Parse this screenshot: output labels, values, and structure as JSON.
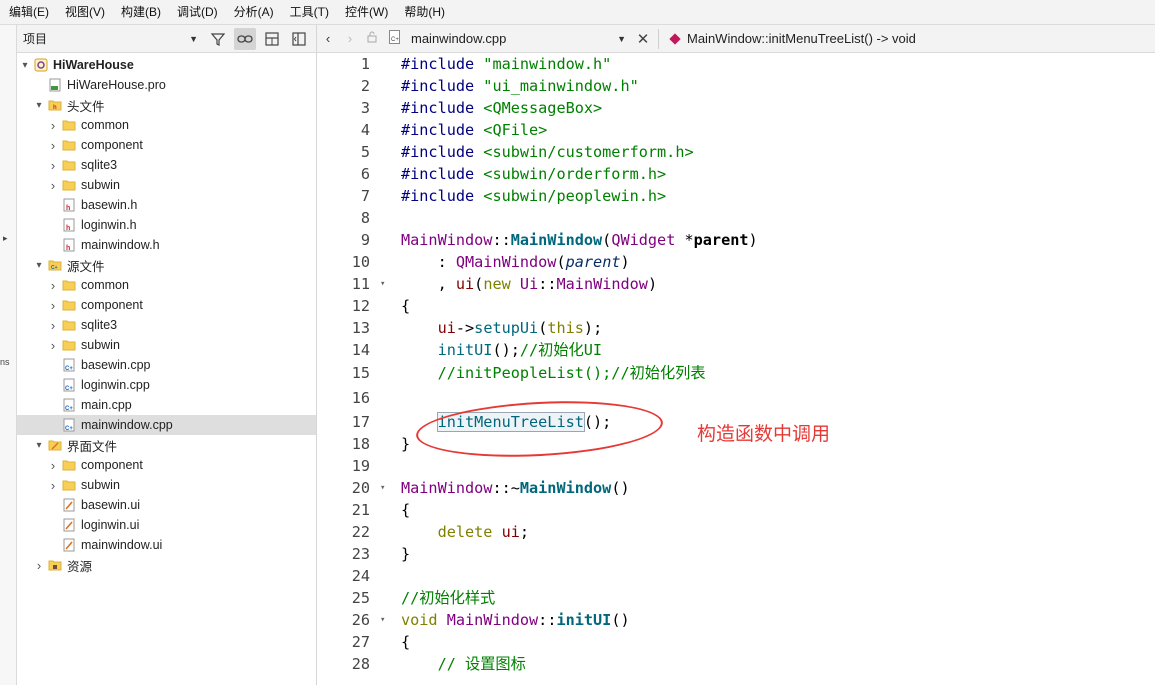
{
  "menu": [
    "编辑(E)",
    "视图(V)",
    "构建(B)",
    "调试(D)",
    "分析(A)",
    "工具(T)",
    "控件(W)",
    "帮助(H)"
  ],
  "mode_strip": {
    "fragment": "ns"
  },
  "project_panel": {
    "selector_label": "项目",
    "tree": [
      {
        "label": "HiWareHouse",
        "depth": 0,
        "arrow": "▾",
        "icon": "project",
        "bold": true
      },
      {
        "label": "HiWareHouse.pro",
        "depth": 1,
        "arrow": "",
        "icon": "pro"
      },
      {
        "label": "头文件",
        "depth": 1,
        "arrow": "▾",
        "icon": "header-folder"
      },
      {
        "label": "common",
        "depth": 2,
        "arrow": "›",
        "icon": "folder"
      },
      {
        "label": "component",
        "depth": 2,
        "arrow": "›",
        "icon": "folder"
      },
      {
        "label": "sqlite3",
        "depth": 2,
        "arrow": "›",
        "icon": "folder"
      },
      {
        "label": "subwin",
        "depth": 2,
        "arrow": "›",
        "icon": "folder"
      },
      {
        "label": "basewin.h",
        "depth": 2,
        "arrow": "",
        "icon": "h"
      },
      {
        "label": "loginwin.h",
        "depth": 2,
        "arrow": "",
        "icon": "h"
      },
      {
        "label": "mainwindow.h",
        "depth": 2,
        "arrow": "",
        "icon": "h"
      },
      {
        "label": "源文件",
        "depth": 1,
        "arrow": "▾",
        "icon": "source-folder"
      },
      {
        "label": "common",
        "depth": 2,
        "arrow": "›",
        "icon": "folder"
      },
      {
        "label": "component",
        "depth": 2,
        "arrow": "›",
        "icon": "folder"
      },
      {
        "label": "sqlite3",
        "depth": 2,
        "arrow": "›",
        "icon": "folder"
      },
      {
        "label": "subwin",
        "depth": 2,
        "arrow": "›",
        "icon": "folder"
      },
      {
        "label": "basewin.cpp",
        "depth": 2,
        "arrow": "",
        "icon": "cpp"
      },
      {
        "label": "loginwin.cpp",
        "depth": 2,
        "arrow": "",
        "icon": "cpp"
      },
      {
        "label": "main.cpp",
        "depth": 2,
        "arrow": "",
        "icon": "cpp"
      },
      {
        "label": "mainwindow.cpp",
        "depth": 2,
        "arrow": "",
        "icon": "cpp",
        "selected": true
      },
      {
        "label": "界面文件",
        "depth": 1,
        "arrow": "▾",
        "icon": "form-folder"
      },
      {
        "label": "component",
        "depth": 2,
        "arrow": "›",
        "icon": "folder"
      },
      {
        "label": "subwin",
        "depth": 2,
        "arrow": "›",
        "icon": "folder"
      },
      {
        "label": "basewin.ui",
        "depth": 2,
        "arrow": "",
        "icon": "ui"
      },
      {
        "label": "loginwin.ui",
        "depth": 2,
        "arrow": "",
        "icon": "ui"
      },
      {
        "label": "mainwindow.ui",
        "depth": 2,
        "arrow": "",
        "icon": "ui"
      },
      {
        "label": "资源",
        "depth": 1,
        "arrow": "›",
        "icon": "resource-folder"
      }
    ]
  },
  "editor_toolbar": {
    "file_name": "mainwindow.cpp",
    "function": "MainWindow::initMenuTreeList() -> void"
  },
  "code_lines": [
    {
      "n": "1",
      "fold": "",
      "tokens": [
        {
          "t": "#include ",
          "c": "pp"
        },
        {
          "t": "\"mainwindow.h\"",
          "c": "str"
        }
      ]
    },
    {
      "n": "2",
      "fold": "",
      "tokens": [
        {
          "t": "#include ",
          "c": "pp"
        },
        {
          "t": "\"ui_mainwindow.h\"",
          "c": "str"
        }
      ]
    },
    {
      "n": "3",
      "fold": "",
      "tokens": [
        {
          "t": "#include ",
          "c": "pp"
        },
        {
          "t": "<QMessageBox>",
          "c": "str"
        }
      ]
    },
    {
      "n": "4",
      "fold": "",
      "tokens": [
        {
          "t": "#include ",
          "c": "pp"
        },
        {
          "t": "<QFile>",
          "c": "str"
        }
      ]
    },
    {
      "n": "5",
      "fold": "",
      "tokens": [
        {
          "t": "#include ",
          "c": "pp"
        },
        {
          "t": "<subwin/customerform.h>",
          "c": "str"
        }
      ]
    },
    {
      "n": "6",
      "fold": "",
      "tokens": [
        {
          "t": "#include ",
          "c": "pp"
        },
        {
          "t": "<subwin/orderform.h>",
          "c": "str"
        }
      ]
    },
    {
      "n": "7",
      "fold": "",
      "tokens": [
        {
          "t": "#include ",
          "c": "pp"
        },
        {
          "t": "<subwin/peoplewin.h>",
          "c": "str"
        }
      ]
    },
    {
      "n": "8",
      "fold": "",
      "tokens": []
    },
    {
      "n": "9",
      "fold": "",
      "tokens": [
        {
          "t": "MainWindow",
          "c": "cls"
        },
        {
          "t": "::",
          "c": "plain"
        },
        {
          "t": "MainWindow",
          "c": "fnb"
        },
        {
          "t": "(",
          "c": "plain"
        },
        {
          "t": "QWidget",
          "c": "cls"
        },
        {
          "t": " *",
          "c": "plain"
        },
        {
          "t": "parent",
          "c": "bld"
        },
        {
          "t": ")",
          "c": "plain"
        }
      ]
    },
    {
      "n": "10",
      "fold": "",
      "tokens": [
        {
          "t": "    : ",
          "c": "plain"
        },
        {
          "t": "QMainWindow",
          "c": "cls"
        },
        {
          "t": "(",
          "c": "plain"
        },
        {
          "t": "parent",
          "c": "it"
        },
        {
          "t": ")",
          "c": "plain"
        }
      ]
    },
    {
      "n": "11",
      "fold": "▾",
      "tokens": [
        {
          "t": "    , ",
          "c": "plain"
        },
        {
          "t": "ui",
          "c": "memb"
        },
        {
          "t": "(",
          "c": "plain"
        },
        {
          "t": "new",
          "c": "kw"
        },
        {
          "t": " ",
          "c": "plain"
        },
        {
          "t": "Ui",
          "c": "cls"
        },
        {
          "t": "::",
          "c": "plain"
        },
        {
          "t": "MainWindow",
          "c": "cls"
        },
        {
          "t": ")",
          "c": "plain"
        }
      ]
    },
    {
      "n": "12",
      "fold": "",
      "tokens": [
        {
          "t": "{",
          "c": "plain"
        }
      ]
    },
    {
      "n": "13",
      "fold": "",
      "tokens": [
        {
          "t": "    ",
          "c": "plain"
        },
        {
          "t": "ui",
          "c": "memb"
        },
        {
          "t": "->",
          "c": "plain"
        },
        {
          "t": "setupUi",
          "c": "fn"
        },
        {
          "t": "(",
          "c": "plain"
        },
        {
          "t": "this",
          "c": "kw"
        },
        {
          "t": ");",
          "c": "plain"
        }
      ]
    },
    {
      "n": "14",
      "fold": "",
      "tokens": [
        {
          "t": "    ",
          "c": "plain"
        },
        {
          "t": "initUI",
          "c": "fn"
        },
        {
          "t": "();",
          "c": "plain"
        },
        {
          "t": "//初始化UI",
          "c": "cmt"
        }
      ]
    },
    {
      "n": "15",
      "fold": "",
      "tokens": [
        {
          "t": "    //initPeopleList();//初始化列表",
          "c": "cmt"
        }
      ]
    },
    {
      "n": "16",
      "fold": "",
      "tokens": []
    },
    {
      "n": "17",
      "fold": "",
      "tokens": [
        {
          "t": "    ",
          "c": "plain"
        },
        {
          "t": "initMenuTreeList",
          "c": "fn hlbox"
        },
        {
          "t": "();",
          "c": "plain"
        }
      ]
    },
    {
      "n": "18",
      "fold": "",
      "tokens": [
        {
          "t": "}",
          "c": "plain"
        }
      ]
    },
    {
      "n": "19",
      "fold": "",
      "tokens": []
    },
    {
      "n": "20",
      "fold": "▾",
      "tokens": [
        {
          "t": "MainWindow",
          "c": "cls"
        },
        {
          "t": "::~",
          "c": "plain"
        },
        {
          "t": "MainWindow",
          "c": "fnb"
        },
        {
          "t": "()",
          "c": "plain"
        }
      ]
    },
    {
      "n": "21",
      "fold": "",
      "tokens": [
        {
          "t": "{",
          "c": "plain"
        }
      ]
    },
    {
      "n": "22",
      "fold": "",
      "tokens": [
        {
          "t": "    ",
          "c": "plain"
        },
        {
          "t": "delete",
          "c": "kw"
        },
        {
          "t": " ",
          "c": "plain"
        },
        {
          "t": "ui",
          "c": "memb"
        },
        {
          "t": ";",
          "c": "plain"
        }
      ]
    },
    {
      "n": "23",
      "fold": "",
      "tokens": [
        {
          "t": "}",
          "c": "plain"
        }
      ]
    },
    {
      "n": "24",
      "fold": "",
      "tokens": []
    },
    {
      "n": "25",
      "fold": "",
      "tokens": [
        {
          "t": "//初始化样式",
          "c": "cmt"
        }
      ]
    },
    {
      "n": "26",
      "fold": "▾",
      "tokens": [
        {
          "t": "void",
          "c": "kw"
        },
        {
          "t": " ",
          "c": "plain"
        },
        {
          "t": "MainWindow",
          "c": "cls"
        },
        {
          "t": "::",
          "c": "plain"
        },
        {
          "t": "initUI",
          "c": "fnb"
        },
        {
          "t": "()",
          "c": "plain"
        }
      ]
    },
    {
      "n": "27",
      "fold": "",
      "tokens": [
        {
          "t": "{",
          "c": "plain"
        }
      ]
    },
    {
      "n": "28",
      "fold": "",
      "tokens": [
        {
          "t": "    // 设置图标",
          "c": "cmt"
        }
      ]
    }
  ],
  "annotation": {
    "text": "构造函数中调用",
    "color": "#e53935"
  }
}
